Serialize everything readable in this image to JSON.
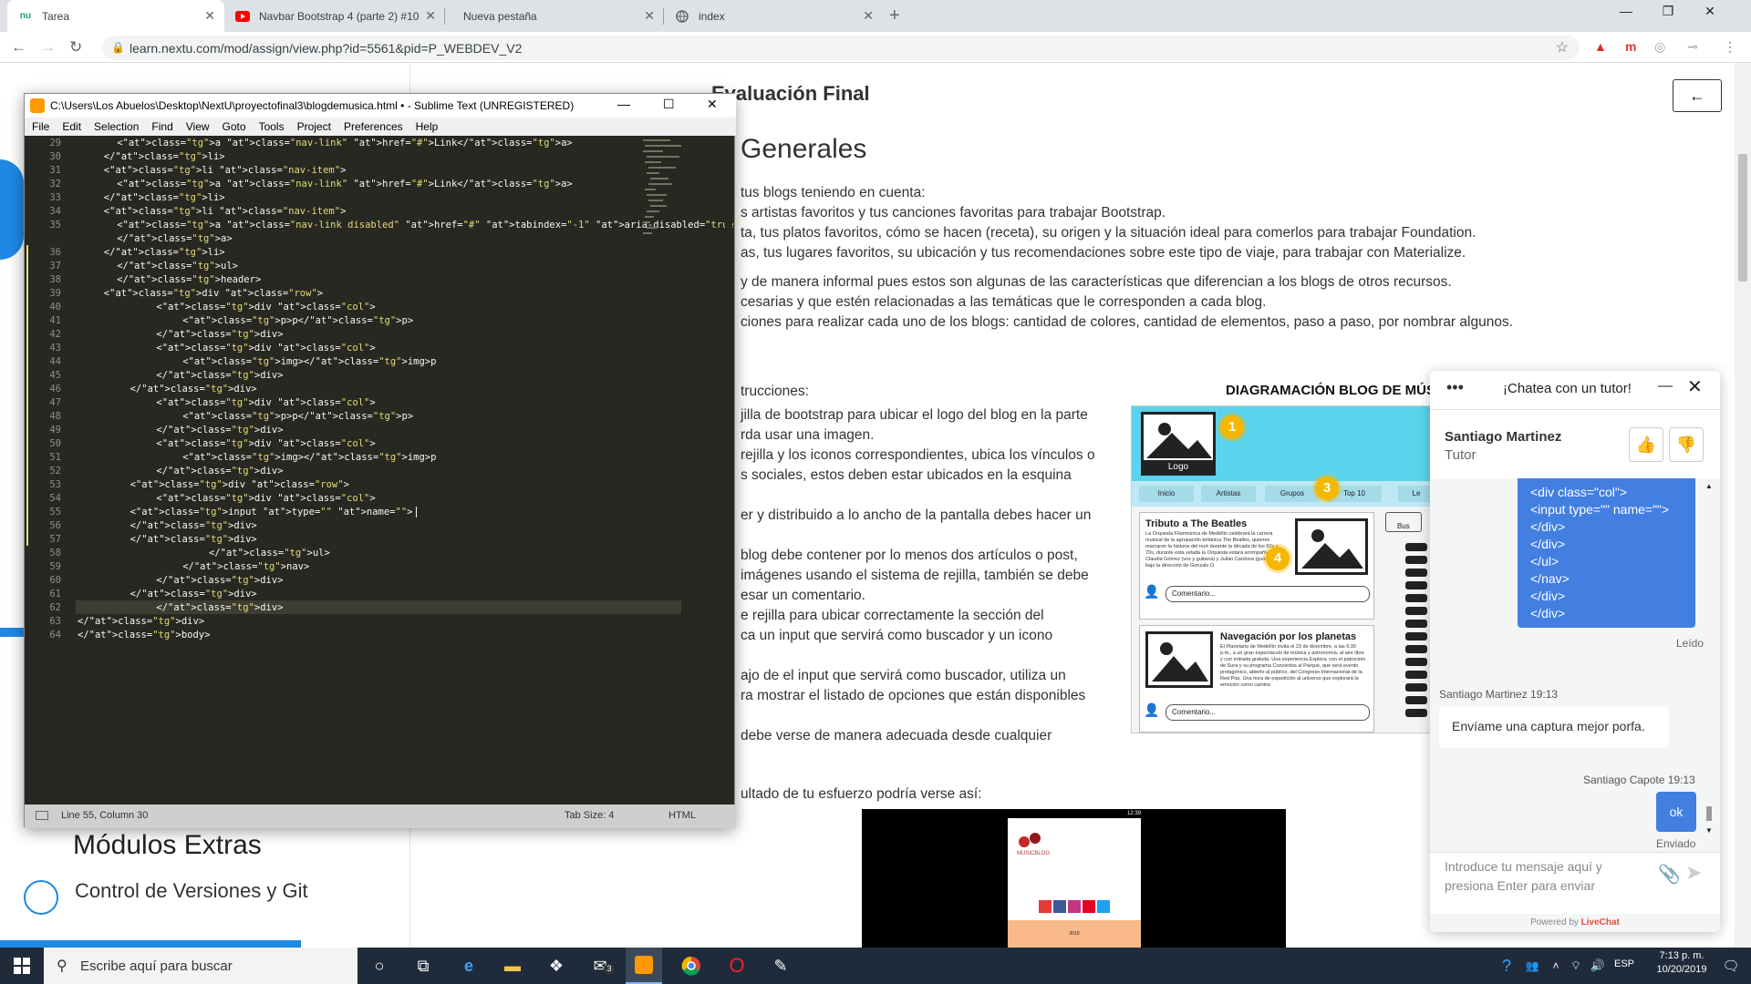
{
  "browser": {
    "tabs": [
      {
        "title": "Tarea",
        "favicon": "nu"
      },
      {
        "title": "Navbar Bootstrap 4 (parte 2) #10",
        "favicon": "youtube-icon"
      },
      {
        "title": "Nueva pestaña",
        "favicon": ""
      },
      {
        "title": "index",
        "favicon": "globe-icon"
      }
    ],
    "url": "learn.nextu.com/mod/assign/view.php?id=5561&pid=P_WEBDEV_V2"
  },
  "page": {
    "heading": "Evaluación Final",
    "section": "Generales",
    "intro": "tus blogs teniendo en cuenta:",
    "bullets": [
      "s artistas favoritos y tus canciones favoritas para trabajar Bootstrap.",
      "ta, tus platos favoritos, cómo se hacen (receta), su origen y la situación ideal para comerlos para trabajar Foundation.",
      "as, tus lugares favoritos, su ubicación y tus recomendaciones sobre este tipo de viaje, para trabajar con Materialize."
    ],
    "para2": [
      "y de manera informal pues estos son algunas de las características que diferencian a los blogs de otros recursos.",
      "cesarias y que estén relacionadas a las temáticas que le corresponden a cada blog.",
      "ciones para realizar cada uno de los blogs: cantidad de colores, cantidad de elementos, paso a paso, por nombrar algunos."
    ],
    "instructions_label": "trucciones:",
    "instructions": [
      "jilla de bootstrap para ubicar el logo del blog en la parte",
      "rda usar una imagen.",
      "rejilla y los iconos correspondientes, ubica los vínculos o",
      "s sociales, estos deben estar ubicados en la esquina",
      "",
      "er y distribuido a lo ancho de la pantalla debes hacer un",
      "",
      "blog debe contener por lo menos dos artículos o post,",
      "imágenes usando el sistema de rejilla, también se debe",
      "esar un comentario.",
      "e rejilla para ubicar correctamente la sección del",
      "ca un input que servirá como buscador y un icono",
      "",
      "ajo de el input que servirá como buscador, utiliza un",
      "ra mostrar el listado de opciones que están disponibles",
      "",
      "debe verse de manera adecuada desde cualquier"
    ],
    "result_text": "ultado de tu esfuerzo podría verse así:",
    "diagram_title": "DIAGRAMACIÓN BLOG DE MÚSI",
    "diagram": {
      "logo": "Logo",
      "nav": [
        "Inicio",
        "Artistas",
        "Grupos",
        "Top 10",
        "Le"
      ],
      "badges": [
        "1",
        "3",
        "4"
      ],
      "post1_title": "Tributo a The Beatles",
      "post1_text": "La Orquesta Filarmónica de Medellín celebrará la carrera musical de la agrupación británica The Beatles, quienes marcaron la historia del rock durante la década de los 60s y 70s, durante esta velada la Orquesta estará acompañada por Claudia Gómez (voz y guitarra) y Julián Cardona (guitarra), bajo la dirección de Gonzalo O",
      "comment": "Comentario...",
      "post2_title": "Navegación por los planetas",
      "post2_text": "El Planetario de Medellín invita el 23 de diciembre, a las 6:30 p.m., a un gran espectáculo de música y astronomía, al aire libre y con entrada gratuita. Una experiencia Explora, con el patrocinio de Sura y su programa Conciertos al Parque, que será evento protagónico, abierto al público, del Congreso Internacional de la Red Pop. Una hora de expedición al universo que explorará la emoción como camino",
      "search_hint": "Bus"
    },
    "phone": {
      "status": "12:39",
      "brand": "MUSICBLOG",
      "footer": "2019"
    }
  },
  "left": {
    "modulos": "Módulos Extras",
    "control": "Control de Versiones y Git"
  },
  "sublime": {
    "title": "C:\\Users\\Los Abuelos\\Desktop\\NextU\\proyectofinal3\\blogdemusica.html • - Sublime Text (UNREGISTERED)",
    "menu": [
      "File",
      "Edit",
      "Selection",
      "Find",
      "View",
      "Goto",
      "Tools",
      "Project",
      "Preferences",
      "Help"
    ],
    "status_left": "Line 55, Column 30",
    "status_tab": "Tab Size: 4",
    "status_syntax": "HTML",
    "lines": [
      {
        "n": "29",
        "ind": 6,
        "code": "<a class=\"nav-link\" href=\"#\">Link</a>"
      },
      {
        "n": "30",
        "ind": 4,
        "code": "</li>"
      },
      {
        "n": "31",
        "ind": 4,
        "code": "<li class=\"nav-item\">"
      },
      {
        "n": "32",
        "ind": 6,
        "code": "<a class=\"nav-link\" href=\"#\">Link</a>"
      },
      {
        "n": "33",
        "ind": 4,
        "code": "</li>"
      },
      {
        "n": "34",
        "ind": 4,
        "code": "<li class=\"nav-item\">"
      },
      {
        "n": "35",
        "ind": 6,
        "code": "<a class=\"nav-link disabled\" href=\"#\" tabindex=\"-1\" aria-disabled=\"true\">Disabled"
      },
      {
        "n": "",
        "ind": 6,
        "code": "</a>"
      },
      {
        "n": "36",
        "ind": 4,
        "code": "</li>"
      },
      {
        "n": "37",
        "ind": 6,
        "code": "</ul>"
      },
      {
        "n": "38",
        "ind": 6,
        "code": "</header>"
      },
      {
        "n": "39",
        "ind": 4,
        "code": "<div class=\"row\">"
      },
      {
        "n": "40",
        "ind": 12,
        "code": "<div class=\"col\">"
      },
      {
        "n": "41",
        "ind": 16,
        "code": "<p>p</p>"
      },
      {
        "n": "42",
        "ind": 12,
        "code": "</div>"
      },
      {
        "n": "43",
        "ind": 12,
        "code": "<div class=\"col\">"
      },
      {
        "n": "44",
        "ind": 16,
        "code": "<img></img>p"
      },
      {
        "n": "45",
        "ind": 12,
        "code": "</div>"
      },
      {
        "n": "46",
        "ind": 8,
        "code": "</div>"
      },
      {
        "n": "47",
        "ind": 12,
        "code": "<div class=\"col\">"
      },
      {
        "n": "48",
        "ind": 16,
        "code": "<p>p</p>"
      },
      {
        "n": "49",
        "ind": 12,
        "code": "</div>"
      },
      {
        "n": "50",
        "ind": 12,
        "code": "<div class=\"col\">"
      },
      {
        "n": "51",
        "ind": 16,
        "code": "<img></img>p"
      },
      {
        "n": "52",
        "ind": 12,
        "code": "</div>"
      },
      {
        "n": "53",
        "ind": 8,
        "code": "<div class=\"row\">"
      },
      {
        "n": "54",
        "ind": 12,
        "code": "<div class=\"col\">"
      },
      {
        "n": "55",
        "ind": 8,
        "code": "<input type=\"\" name=\"\">"
      },
      {
        "n": "56",
        "ind": 8,
        "code": "</div>"
      },
      {
        "n": "57",
        "ind": 8,
        "code": "</div>"
      },
      {
        "n": "58",
        "ind": 20,
        "code": "</ul>"
      },
      {
        "n": "59",
        "ind": 16,
        "code": "</nav>"
      },
      {
        "n": "60",
        "ind": 12,
        "code": "</div>"
      },
      {
        "n": "61",
        "ind": 8,
        "code": "</div>"
      },
      {
        "n": "62",
        "ind": 12,
        "code": "</div>"
      },
      {
        "n": "63",
        "ind": 0,
        "code": "</div>"
      },
      {
        "n": "64",
        "ind": 0,
        "code": "</body>"
      }
    ]
  },
  "chat": {
    "header": "¡Chatea con un tutor!",
    "agent_name": "Santiago Martinez",
    "agent_role": "Tutor",
    "code_msg": [
      "<div class=\"col\">",
      "<input type=\"\" name=\"\">",
      "</div>",
      "</div>",
      "</ul>",
      "</nav>",
      "</div>",
      "</div>"
    ],
    "read": "Leído",
    "agent_meta": "Santiago Martinez 19:13",
    "agent_msg": "Envíame una captura mejor porfa.",
    "user_meta": "Santiago Capote 19:13",
    "user_msg": "ok",
    "sent": "Enviado",
    "input_placeholder": "Introduce tu mensaje aquí y presiona Enter para enviar",
    "powered": "Powered by",
    "brand": "LiveChat"
  },
  "taskbar": {
    "search_placeholder": "Escribe aquí para buscar",
    "lang": "ESP",
    "time": "7:13 p. m.",
    "date": "10/20/2019",
    "mail_badge": "3"
  },
  "colors": {
    "accent": "#1a73e8",
    "chat_blue": "#427fe1",
    "sublime_bg": "#272822",
    "taskbar": "#1f2b3a"
  }
}
